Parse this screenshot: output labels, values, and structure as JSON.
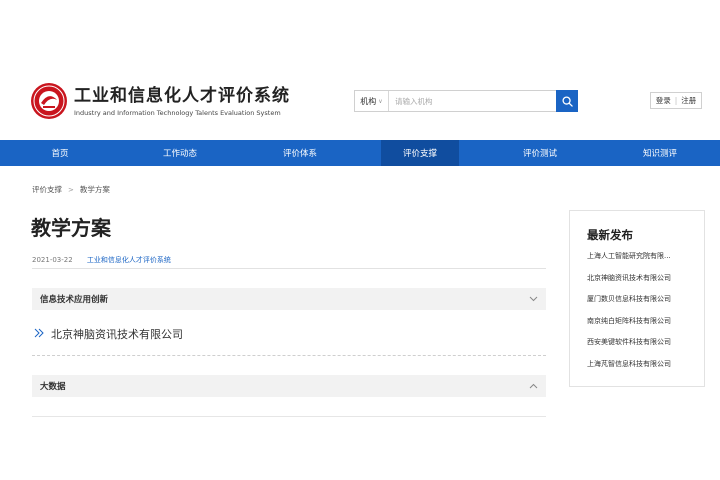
{
  "header": {
    "title": "工业和信息化人才评价系统",
    "subtitle": "Industry and Information Technology Talents Evaluation System"
  },
  "search": {
    "category": "机构",
    "placeholder": "请输入机构"
  },
  "auth": {
    "login": "登录",
    "separator": "|",
    "register": "注册"
  },
  "nav": {
    "items": [
      {
        "label": "首页"
      },
      {
        "label": "工作动态"
      },
      {
        "label": "评价体系"
      },
      {
        "label": "评价支撑"
      },
      {
        "label": "评价测试"
      },
      {
        "label": "知识测评"
      }
    ],
    "active_index": 3
  },
  "breadcrumb": {
    "items": [
      "评价支撑",
      "教学方案"
    ]
  },
  "article": {
    "title": "教学方案",
    "date": "2021-03-22",
    "source": "工业和信息化人才评价系统"
  },
  "sections": [
    {
      "title": "信息技术应用创新",
      "expanded": true,
      "items": [
        "北京神脑资讯技术有限公司"
      ]
    },
    {
      "title": "大数据",
      "expanded": false,
      "items": []
    }
  ],
  "sidebar": {
    "title": "最新发布",
    "items": [
      "上海人工智能研究院有限...",
      "北京神脑资讯技术有限公司",
      "厦门数贝信息科技有限公司",
      "南京纯白矩阵科技有限公司",
      "西安美键软件科技有限公司",
      "上海芃智信息科技有限公司"
    ]
  },
  "colors": {
    "primary": "#1a64c4",
    "nav_active": "#104d9f",
    "logo_red": "#c9151e"
  },
  "icons": {
    "logo": "emblem-logo",
    "search": "search-icon",
    "breadcrumb_separator": "chevron-right-icon",
    "section_expanded": "chevron-down-icon",
    "section_collapsed": "chevron-up-icon",
    "list_bullet": "double-chevron-right-icon"
  }
}
